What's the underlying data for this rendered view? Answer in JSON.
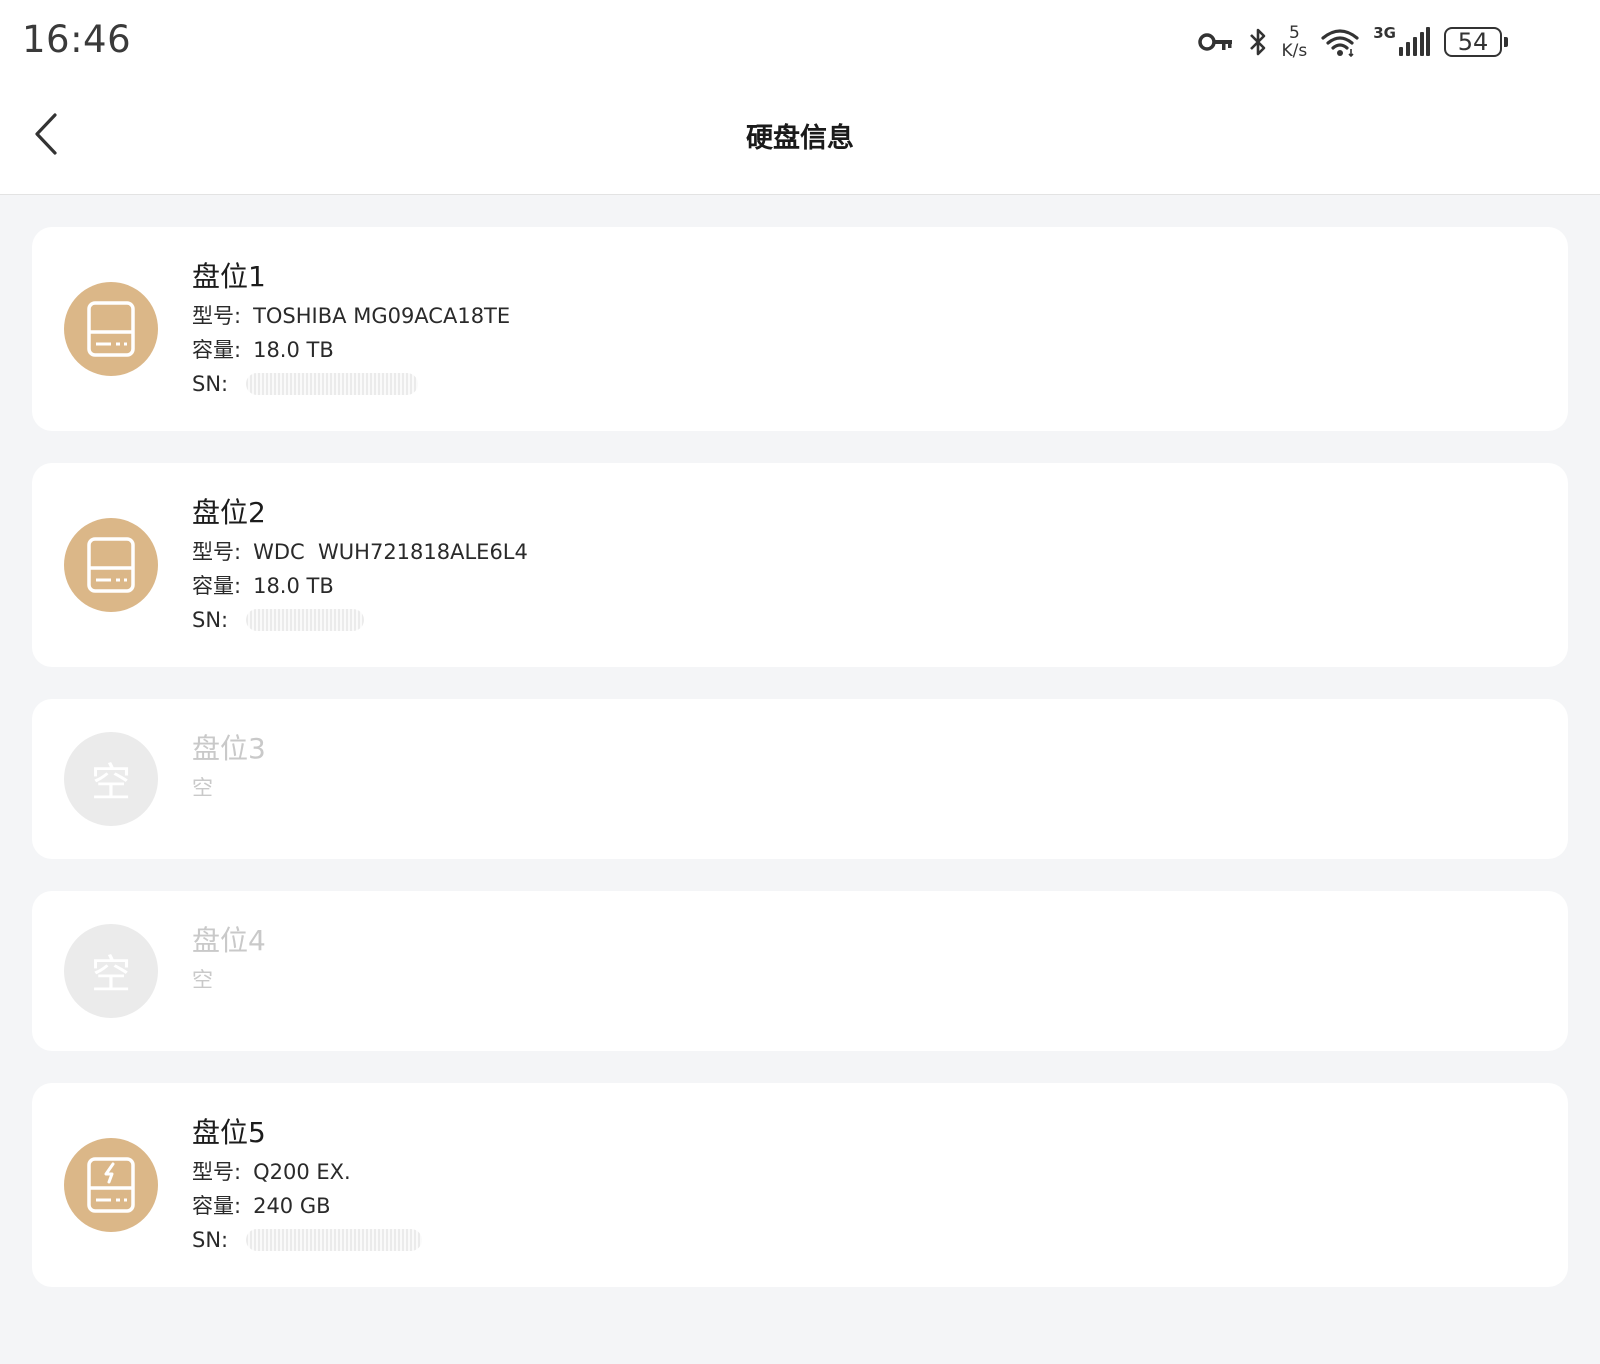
{
  "status_bar": {
    "time": "16:46",
    "net_speed_value": "5",
    "net_speed_unit": "K/s",
    "network_type": "3G",
    "battery": "54",
    "icons": [
      "vpn-key-icon",
      "bluetooth-icon",
      "wifi-icon",
      "signal-icon",
      "battery-icon"
    ]
  },
  "nav": {
    "title": "硬盘信息",
    "back_icon": "chevron-left-icon"
  },
  "labels": {
    "model": "型号:",
    "capacity": "容量:",
    "sn": "SN:"
  },
  "colors": {
    "accent": "#dbb788",
    "empty": "#ebebeb"
  },
  "slots": [
    {
      "title": "盘位1",
      "model": "TOSHIBA MG09ACA18TE",
      "capacity": "18.0 TB",
      "icon": "hdd-icon"
    },
    {
      "title": "盘位2",
      "model": "WDC  WUH721818ALE6L4",
      "capacity": "18.0 TB",
      "icon": "hdd-icon"
    },
    {
      "title": "盘位3",
      "empty_label": "空",
      "avatar_text": "空"
    },
    {
      "title": "盘位4",
      "empty_label": "空",
      "avatar_text": "空"
    },
    {
      "title": "盘位5",
      "model": "Q200 EX.",
      "capacity": "240 GB",
      "icon": "ssd-icon"
    }
  ]
}
